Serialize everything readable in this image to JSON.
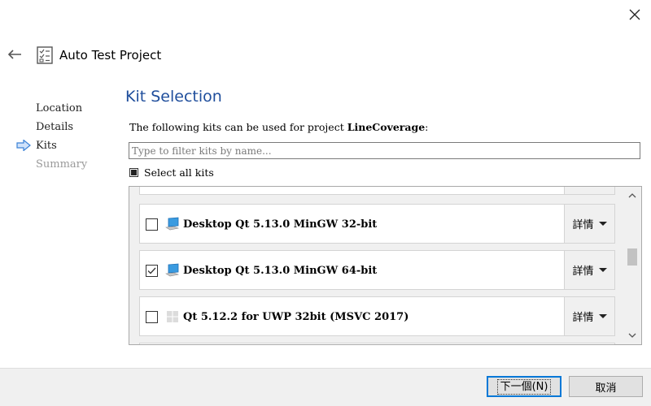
{
  "window": {
    "title": "Auto Test Project"
  },
  "steps": [
    {
      "label": "Location",
      "state": "done"
    },
    {
      "label": "Details",
      "state": "done"
    },
    {
      "label": "Kits",
      "state": "current"
    },
    {
      "label": "Summary",
      "state": "pending"
    }
  ],
  "page": {
    "heading": "Kit Selection",
    "description_prefix": "The following kits can be used for project ",
    "project_name": "LineCoverage",
    "description_suffix": ":",
    "filter_placeholder": "Type to filter kits by name...",
    "select_all_label": "Select all kits",
    "select_all_state": "partial"
  },
  "kits": [
    {
      "name": "Desktop Qt 5.13.0 MinGW 32-bit",
      "checked": false,
      "icon": "desktop-monitor-icon",
      "details_label": "詳情"
    },
    {
      "name": "Desktop Qt 5.13.0 MinGW 64-bit",
      "checked": true,
      "icon": "desktop-monitor-icon",
      "details_label": "詳情"
    },
    {
      "name": "Qt 5.12.2 for UWP 32bit (MSVC 2017)",
      "checked": false,
      "icon": "windows-logo-icon",
      "details_label": "詳情"
    }
  ],
  "buttons": {
    "next": "下一個(N)",
    "cancel": "取消"
  },
  "colors": {
    "heading": "#1f4e9c",
    "accent": "#0078d7",
    "arrow": "#3b82d6"
  }
}
